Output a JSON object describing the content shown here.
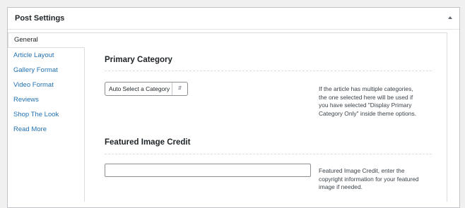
{
  "postbox": {
    "title": "Post Settings"
  },
  "tabs": [
    {
      "label": "General"
    },
    {
      "label": "Article Layout"
    },
    {
      "label": "Gallery Format"
    },
    {
      "label": "Video Format"
    },
    {
      "label": "Reviews"
    },
    {
      "label": "Shop The Look"
    },
    {
      "label": "Read More"
    }
  ],
  "general": {
    "primary_category": {
      "heading": "Primary Category",
      "select_value": "Auto Select a Category",
      "description_lines": [
        "If the article has multiple categories,",
        "the one selected here will be used if",
        "you have selected \"Display Primary",
        "Category Only\" inside theme options."
      ]
    },
    "featured_image_credit": {
      "heading": "Featured Image Credit",
      "input_value": "",
      "description_lines": [
        "Featured Image Credit, enter the",
        "copyright information for your featured",
        "image if needed."
      ]
    }
  },
  "colors": {
    "link": "#2271b1",
    "text": "#1d2327",
    "border": "#dcdcde",
    "background": "#f0f0f1"
  },
  "icons": {
    "toggle": "triangle-up-icon",
    "select_caret": "up-down-caret-icon"
  }
}
